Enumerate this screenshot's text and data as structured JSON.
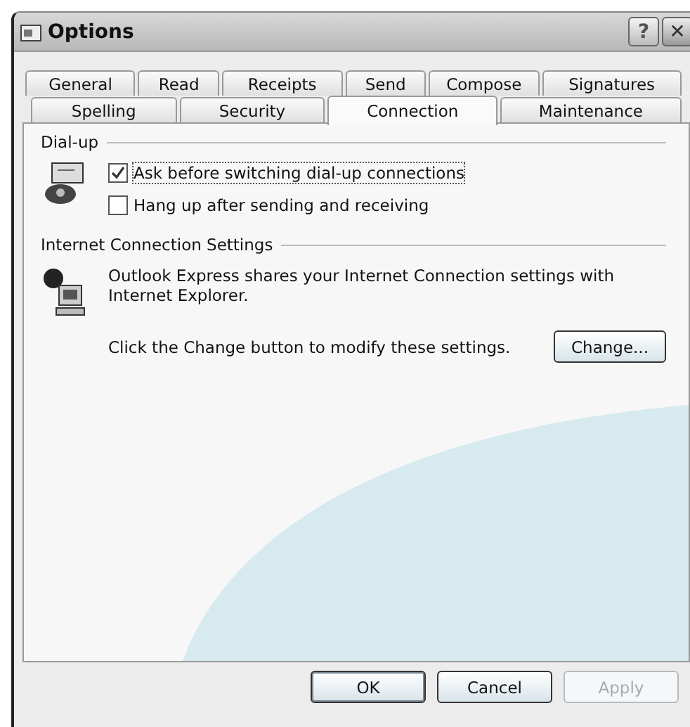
{
  "window": {
    "title": "Options"
  },
  "title_buttons": [
    {
      "kind": "help",
      "label": "?"
    },
    {
      "kind": "close",
      "label": "✕"
    }
  ],
  "tab_rows": [
    [
      {
        "label": "General",
        "selected": false
      },
      {
        "label": "Read",
        "selected": false
      },
      {
        "label": "Receipts",
        "selected": false
      },
      {
        "label": "Send",
        "selected": false
      },
      {
        "label": "Compose",
        "selected": false
      },
      {
        "label": "Signatures",
        "selected": false
      }
    ],
    [
      {
        "label": "Spelling",
        "selected": false
      },
      {
        "label": "Security",
        "selected": false
      },
      {
        "label": "Connection",
        "selected": true
      },
      {
        "label": "Maintenance",
        "selected": false
      }
    ]
  ],
  "dial_up": {
    "title": "Dial-up",
    "options": [
      {
        "label": "Ask before switching dial-up connections",
        "checked": true
      },
      {
        "label": "Hang up after sending and receiving",
        "checked": false
      }
    ]
  },
  "internet_connection": {
    "title": "Internet Connection Settings",
    "description": "Outlook Express shares your Internet Connection settings with Internet Explorer.",
    "hint": "Click the Change button to modify these settings.",
    "button": "Change..."
  },
  "buttons": [
    {
      "label": "OK",
      "default": true,
      "disabled": false
    },
    {
      "label": "Cancel",
      "default": false,
      "disabled": false
    },
    {
      "label": "Apply",
      "default": false,
      "disabled": true
    }
  ]
}
